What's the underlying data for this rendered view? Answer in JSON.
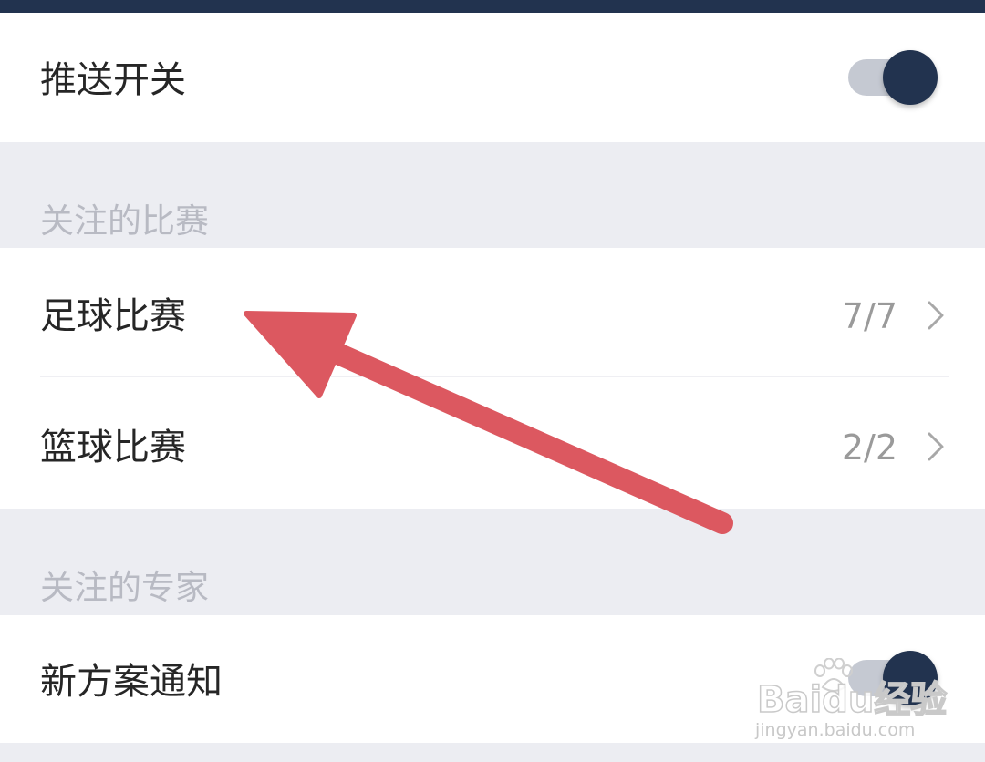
{
  "push_switch": {
    "label": "推送开关",
    "enabled": true
  },
  "followed_matches": {
    "title": "关注的比赛",
    "items": [
      {
        "label": "足球比赛",
        "count": "7/7"
      },
      {
        "label": "篮球比赛",
        "count": "2/2"
      }
    ]
  },
  "followed_experts": {
    "title": "关注的专家",
    "new_plan_notice": {
      "label": "新方案通知",
      "enabled": true
    }
  },
  "watermark": {
    "logo": "Baidu经验",
    "url": "jingyan.baidu.com"
  },
  "colors": {
    "accent": "#22334f",
    "toggle_track": "#c5c9d2",
    "section_bg": "#ecedf2",
    "annotation_arrow": "#dc5860"
  },
  "icons": {
    "row_chevron": "chevron-right-icon",
    "annotation": "arrow-annotation-icon"
  }
}
